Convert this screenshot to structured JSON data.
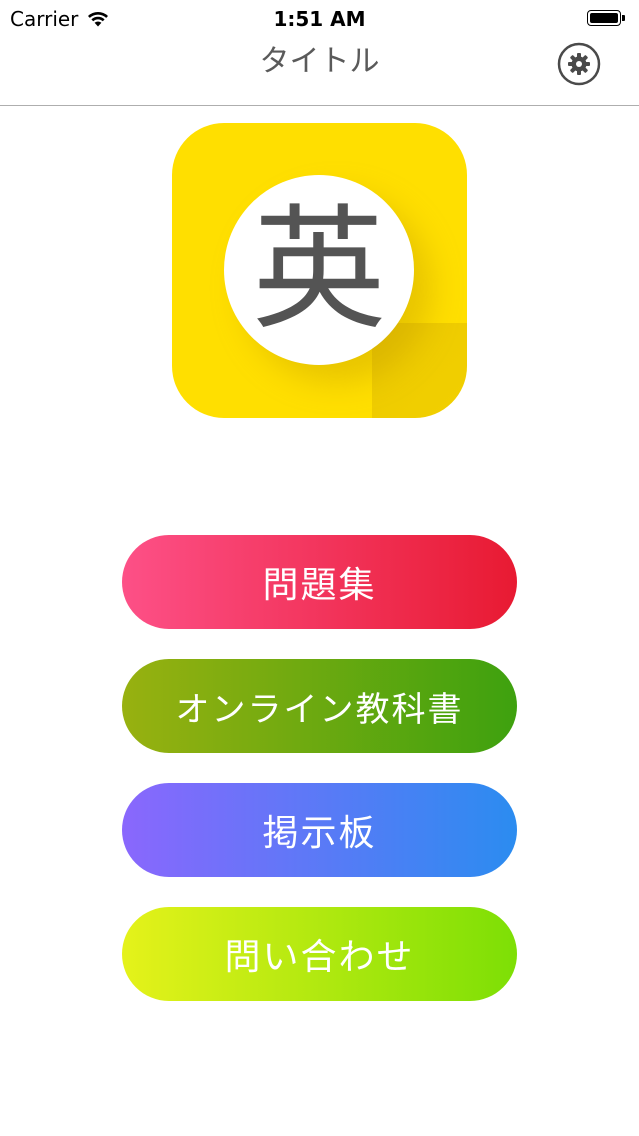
{
  "status_bar": {
    "carrier": "Carrier",
    "time": "1:51 AM",
    "wifi_icon": "wifi-icon",
    "battery_icon": "battery-icon"
  },
  "navbar": {
    "title": "タイトル",
    "settings_icon": "gear-icon"
  },
  "logo": {
    "glyph": "英",
    "background_color": "#ffdf00"
  },
  "menu": {
    "items": [
      {
        "label": "問題集"
      },
      {
        "label": "オンライン教科書"
      },
      {
        "label": "掲示板"
      },
      {
        "label": "問い合わせ"
      }
    ]
  }
}
